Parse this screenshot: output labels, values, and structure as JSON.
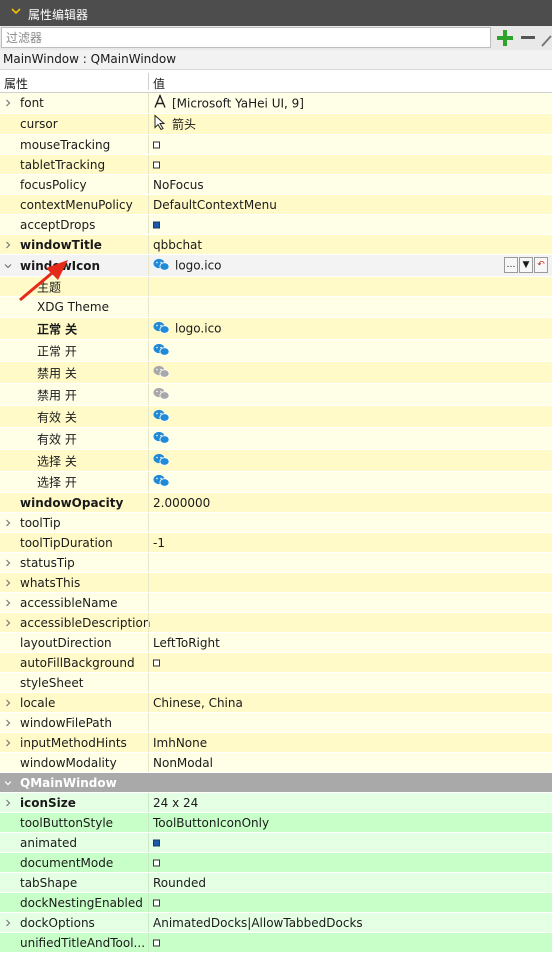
{
  "panel": {
    "title": "属性编辑器"
  },
  "filter": {
    "placeholder": "过滤器",
    "value": ""
  },
  "object_class": "MainWindow : QMainWindow",
  "columns": {
    "property": "属性",
    "value": "值"
  },
  "colors": {
    "yellow": "#ffffe7",
    "yellow_alt": "#fffac8",
    "green": "#e5ffe5",
    "green_alt": "#c8ffc8",
    "section": "#a9a9a9",
    "accent_add": "#2ca42c",
    "arrow_red": "#e62a1a"
  },
  "rows": [
    {
      "name": "font",
      "value": "[Microsoft YaHei UI, 9]",
      "icon": "font-icon",
      "expander": true,
      "bold": false,
      "h": 21,
      "indent": 0,
      "group": "yellow"
    },
    {
      "name": "cursor",
      "value": "箭头",
      "icon": "cursor-arrow-icon",
      "expander": false,
      "bold": false,
      "h": 21,
      "indent": 0,
      "group": "yellow"
    },
    {
      "name": "mouseTracking",
      "check": false,
      "expander": false,
      "bold": false,
      "h": 20,
      "indent": 0,
      "group": "yellow"
    },
    {
      "name": "tabletTracking",
      "check": false,
      "expander": false,
      "bold": false,
      "h": 20,
      "indent": 0,
      "group": "yellow"
    },
    {
      "name": "focusPolicy",
      "value": "NoFocus",
      "expander": false,
      "bold": false,
      "h": 20,
      "indent": 0,
      "group": "yellow"
    },
    {
      "name": "contextMenuPolicy",
      "value": "DefaultContextMenu",
      "expander": false,
      "bold": false,
      "h": 20,
      "indent": 0,
      "group": "yellow"
    },
    {
      "name": "acceptDrops",
      "check": true,
      "expander": false,
      "bold": false,
      "h": 20,
      "indent": 0,
      "group": "yellow"
    },
    {
      "name": "windowTitle",
      "value": "qbbchat",
      "expander": true,
      "bold": true,
      "h": 20,
      "indent": 0,
      "group": "yellow"
    },
    {
      "name": "windowIcon",
      "value": "logo.ico",
      "icon": "wechat-icon",
      "expander": true,
      "expanded": true,
      "bold": true,
      "h": 22,
      "indent": 0,
      "group": "selected",
      "buttons": true
    },
    {
      "name": "主题",
      "value": "",
      "expander": false,
      "bold": false,
      "h": 20,
      "indent": 1,
      "group": "yellow"
    },
    {
      "name": "XDG Theme",
      "value": "",
      "expander": false,
      "bold": false,
      "h": 21,
      "indent": 1,
      "group": "yellow"
    },
    {
      "name": "正常 关",
      "value": "logo.ico",
      "icon": "wechat-icon",
      "expander": false,
      "bold": true,
      "h": 22,
      "indent": 1,
      "group": "yellow"
    },
    {
      "name": "正常 开",
      "value": "",
      "icon": "wechat-icon",
      "expander": false,
      "bold": false,
      "h": 22,
      "indent": 1,
      "group": "yellow"
    },
    {
      "name": "禁用 关",
      "value": "",
      "icon": "wechat-gray-icon",
      "expander": false,
      "bold": false,
      "h": 22,
      "indent": 1,
      "group": "yellow"
    },
    {
      "name": "禁用 开",
      "value": "",
      "icon": "wechat-gray-icon",
      "expander": false,
      "bold": false,
      "h": 22,
      "indent": 1,
      "group": "yellow"
    },
    {
      "name": "有效 关",
      "value": "",
      "icon": "wechat-icon",
      "expander": false,
      "bold": false,
      "h": 22,
      "indent": 1,
      "group": "yellow"
    },
    {
      "name": "有效 开",
      "value": "",
      "icon": "wechat-icon",
      "expander": false,
      "bold": false,
      "h": 22,
      "indent": 1,
      "group": "yellow"
    },
    {
      "name": "选择 关",
      "value": "",
      "icon": "wechat-icon",
      "expander": false,
      "bold": false,
      "h": 22,
      "indent": 1,
      "group": "yellow"
    },
    {
      "name": "选择 开",
      "value": "",
      "icon": "wechat-icon",
      "expander": false,
      "bold": false,
      "h": 21,
      "indent": 1,
      "group": "yellow"
    },
    {
      "name": "windowOpacity",
      "value": "2.000000",
      "expander": false,
      "bold": true,
      "h": 20,
      "indent": 0,
      "group": "yellow"
    },
    {
      "name": "toolTip",
      "value": "",
      "expander": true,
      "bold": false,
      "h": 20,
      "indent": 0,
      "group": "yellow"
    },
    {
      "name": "toolTipDuration",
      "value": "-1",
      "expander": false,
      "bold": false,
      "h": 20,
      "indent": 0,
      "group": "yellow"
    },
    {
      "name": "statusTip",
      "value": "",
      "expander": true,
      "bold": false,
      "h": 20,
      "indent": 0,
      "group": "yellow"
    },
    {
      "name": "whatsThis",
      "value": "",
      "expander": true,
      "bold": false,
      "h": 20,
      "indent": 0,
      "group": "yellow"
    },
    {
      "name": "accessibleName",
      "value": "",
      "expander": true,
      "bold": false,
      "h": 20,
      "indent": 0,
      "group": "yellow"
    },
    {
      "name": "accessibleDescription",
      "value": "",
      "expander": true,
      "bold": false,
      "h": 20,
      "indent": 0,
      "group": "yellow"
    },
    {
      "name": "layoutDirection",
      "value": "LeftToRight",
      "expander": false,
      "bold": false,
      "h": 20,
      "indent": 0,
      "group": "yellow"
    },
    {
      "name": "autoFillBackground",
      "check": false,
      "expander": false,
      "bold": false,
      "h": 20,
      "indent": 0,
      "group": "yellow"
    },
    {
      "name": "styleSheet",
      "value": "",
      "expander": false,
      "bold": false,
      "h": 20,
      "indent": 0,
      "group": "yellow"
    },
    {
      "name": "locale",
      "value": "Chinese, China",
      "expander": true,
      "bold": false,
      "h": 20,
      "indent": 0,
      "group": "yellow"
    },
    {
      "name": "windowFilePath",
      "value": "",
      "expander": true,
      "bold": false,
      "h": 20,
      "indent": 0,
      "group": "yellow"
    },
    {
      "name": "inputMethodHints",
      "value": "ImhNone",
      "expander": true,
      "bold": false,
      "h": 20,
      "indent": 0,
      "group": "yellow"
    },
    {
      "name": "windowModality",
      "value": "NonModal",
      "expander": false,
      "bold": false,
      "h": 20,
      "indent": 0,
      "group": "yellow"
    },
    {
      "name": "QMainWindow",
      "section": true,
      "expander": true,
      "expanded": true,
      "bold": true,
      "h": 20,
      "indent": 0,
      "group": "section"
    },
    {
      "name": "iconSize",
      "value": "24 x 24",
      "expander": true,
      "bold": true,
      "h": 20,
      "indent": 0,
      "group": "green"
    },
    {
      "name": "toolButtonStyle",
      "value": "ToolButtonIconOnly",
      "expander": false,
      "bold": false,
      "h": 20,
      "indent": 0,
      "group": "green"
    },
    {
      "name": "animated",
      "check": true,
      "expander": false,
      "bold": false,
      "h": 20,
      "indent": 0,
      "group": "green"
    },
    {
      "name": "documentMode",
      "check": false,
      "expander": false,
      "bold": false,
      "h": 20,
      "indent": 0,
      "group": "green"
    },
    {
      "name": "tabShape",
      "value": "Rounded",
      "expander": false,
      "bold": false,
      "h": 20,
      "indent": 0,
      "group": "green"
    },
    {
      "name": "dockNestingEnabled",
      "check": false,
      "expander": false,
      "bold": false,
      "h": 20,
      "indent": 0,
      "group": "green"
    },
    {
      "name": "dockOptions",
      "value": "AnimatedDocks|AllowTabbedDocks",
      "expander": true,
      "bold": false,
      "h": 20,
      "indent": 0,
      "group": "green"
    },
    {
      "name": "unifiedTitleAndTool...",
      "check": false,
      "expander": false,
      "bold": false,
      "h": 20,
      "indent": 0,
      "group": "green"
    }
  ]
}
